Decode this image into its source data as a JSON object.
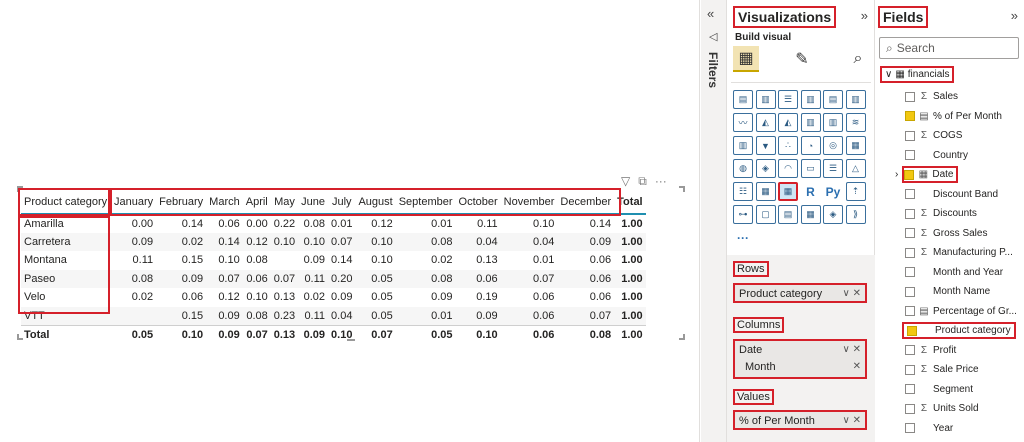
{
  "matrix": {
    "corner_header": "Product category",
    "columns": [
      "January",
      "February",
      "March",
      "April",
      "May",
      "June",
      "July",
      "August",
      "September",
      "October",
      "November",
      "December",
      "Total"
    ],
    "rows": [
      {
        "label": "Amarilla",
        "values": [
          "0.00",
          "0.14",
          "0.06",
          "0.00",
          "0.22",
          "0.08",
          "0.01",
          "0.12",
          "0.01",
          "0.11",
          "0.10",
          "0.14",
          "1.00"
        ]
      },
      {
        "label": "Carretera",
        "values": [
          "0.09",
          "0.02",
          "0.14",
          "0.12",
          "0.10",
          "0.10",
          "0.07",
          "0.10",
          "0.08",
          "0.04",
          "0.04",
          "0.09",
          "1.00"
        ]
      },
      {
        "label": "Montana",
        "values": [
          "0.11",
          "0.15",
          "0.10",
          "0.08",
          "",
          "0.09",
          "0.14",
          "0.10",
          "0.02",
          "0.13",
          "0.01",
          "0.06",
          "1.00"
        ]
      },
      {
        "label": "Paseo",
        "values": [
          "0.08",
          "0.09",
          "0.07",
          "0.06",
          "0.07",
          "0.11",
          "0.20",
          "0.05",
          "0.08",
          "0.06",
          "0.07",
          "0.06",
          "1.00"
        ]
      },
      {
        "label": "Velo",
        "values": [
          "0.02",
          "0.06",
          "0.12",
          "0.10",
          "0.13",
          "0.02",
          "0.09",
          "0.05",
          "0.09",
          "0.19",
          "0.06",
          "0.06",
          "1.00"
        ]
      },
      {
        "label": "VTT",
        "values": [
          "",
          "0.15",
          "0.09",
          "0.08",
          "0.23",
          "0.11",
          "0.04",
          "0.05",
          "0.01",
          "0.09",
          "0.06",
          "0.07",
          "1.00"
        ]
      }
    ],
    "total_row": {
      "label": "Total",
      "values": [
        "0.05",
        "0.10",
        "0.09",
        "0.07",
        "0.13",
        "0.09",
        "0.10",
        "0.07",
        "0.05",
        "0.10",
        "0.06",
        "0.08",
        "1.00"
      ]
    }
  },
  "visual_header_icons": [
    "filter-icon",
    "focus-mode-icon",
    "more-options-icon"
  ],
  "filters": {
    "label": "Filters",
    "collapse_glyph": "«"
  },
  "visualizations": {
    "title": "Visualizations",
    "expand_glyph": "»",
    "build_visual": "Build visual",
    "wells": {
      "rows_label": "Rows",
      "rows_field": "Product category",
      "columns_label": "Columns",
      "columns_fields": [
        "Date",
        "Month"
      ],
      "values_label": "Values",
      "values_field": "% of Per Month"
    },
    "more": "···"
  },
  "fields": {
    "title": "Fields",
    "expand_glyph": "»",
    "search_placeholder": "Search",
    "table_name": "financials",
    "items": [
      {
        "label": "Sales",
        "sigma": true,
        "checked": false
      },
      {
        "label": "% of Per Month",
        "sigma": false,
        "checked": true
      },
      {
        "label": "COGS",
        "sigma": true,
        "checked": false
      },
      {
        "label": "Country",
        "sigma": false,
        "checked": false
      },
      {
        "label": "Date",
        "sigma": false,
        "checked": true
      },
      {
        "label": "Discount Band",
        "sigma": false,
        "checked": false
      },
      {
        "label": "Discounts",
        "sigma": true,
        "checked": false
      },
      {
        "label": "Gross Sales",
        "sigma": true,
        "checked": false
      },
      {
        "label": "Manufacturing P...",
        "sigma": true,
        "checked": false
      },
      {
        "label": "Month and Year",
        "sigma": false,
        "checked": false
      },
      {
        "label": "Month Name",
        "sigma": false,
        "checked": false
      },
      {
        "label": "Percentage of Gr...",
        "sigma": false,
        "checked": false
      },
      {
        "label": "Product category",
        "sigma": false,
        "checked": true
      },
      {
        "label": "Profit",
        "sigma": true,
        "checked": false
      },
      {
        "label": "Sale Price",
        "sigma": true,
        "checked": false
      },
      {
        "label": "Segment",
        "sigma": false,
        "checked": false
      },
      {
        "label": "Units Sold",
        "sigma": true,
        "checked": false
      },
      {
        "label": "Year",
        "sigma": false,
        "checked": false
      }
    ]
  }
}
